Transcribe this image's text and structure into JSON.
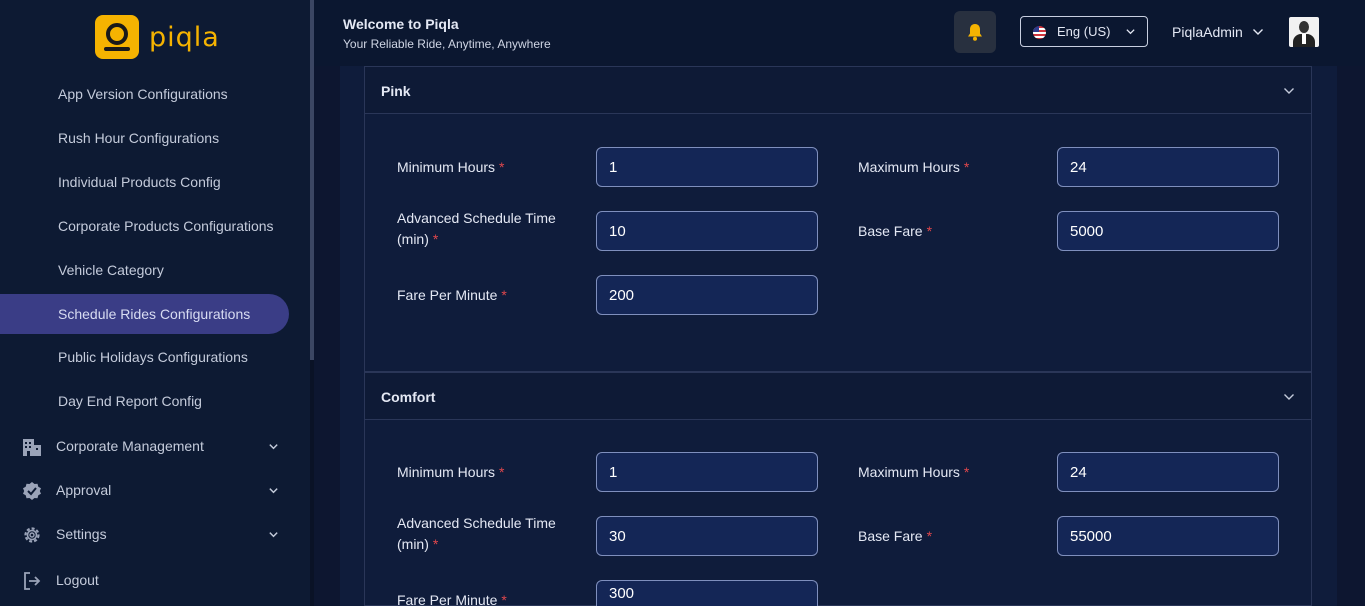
{
  "app": {
    "brand": "piqla",
    "welcome": "Welcome to Piqla",
    "tagline": "Your Reliable Ride, Anytime, Anywhere"
  },
  "header": {
    "language": "Eng (US)",
    "user_name": "PiqlaAdmin"
  },
  "sidebar": {
    "items": [
      {
        "label": "App Version Configurations"
      },
      {
        "label": "Rush Hour Configurations"
      },
      {
        "label": "Individual Products Config"
      },
      {
        "label": "Corporate Products Configurations"
      },
      {
        "label": "Vehicle Category"
      },
      {
        "label": "Schedule Rides Configurations",
        "active": true
      },
      {
        "label": "Public Holidays Configurations"
      },
      {
        "label": "Day End Report Config"
      }
    ],
    "groups": [
      {
        "label": "Corporate Management",
        "icon": "building-icon"
      },
      {
        "label": "Approval",
        "icon": "verified-badge-icon"
      },
      {
        "label": "Settings",
        "icon": "gear-icon"
      },
      {
        "label": "Logout",
        "icon": "logout-icon"
      }
    ]
  },
  "panels": [
    {
      "title": "Pink",
      "fields": {
        "min_hours": {
          "label": "Minimum Hours",
          "value": "1"
        },
        "max_hours": {
          "label": "Maximum Hours",
          "value": "24"
        },
        "adv_time_line1": "Advanced Schedule Time",
        "adv_time_line2": "(min)",
        "adv_time_value": "10",
        "base_fare": {
          "label": "Base Fare",
          "value": "5000"
        },
        "fare_per_minute": {
          "label": "Fare Per Minute",
          "value": "200"
        }
      }
    },
    {
      "title": "Comfort",
      "fields": {
        "min_hours": {
          "label": "Minimum Hours",
          "value": "1"
        },
        "max_hours": {
          "label": "Maximum Hours",
          "value": "24"
        },
        "adv_time_line1": "Advanced Schedule Time",
        "adv_time_line2": "(min)",
        "adv_time_value": "30",
        "base_fare": {
          "label": "Base Fare",
          "value": "55000"
        },
        "fare_per_minute": {
          "label": "Fare Per Minute",
          "value": "300"
        }
      }
    }
  ],
  "required_marker": "*",
  "colors": {
    "brand": "#f5b301",
    "active_nav": "#3a3d86",
    "required": "#e0474c",
    "bell": "#f5b301"
  }
}
